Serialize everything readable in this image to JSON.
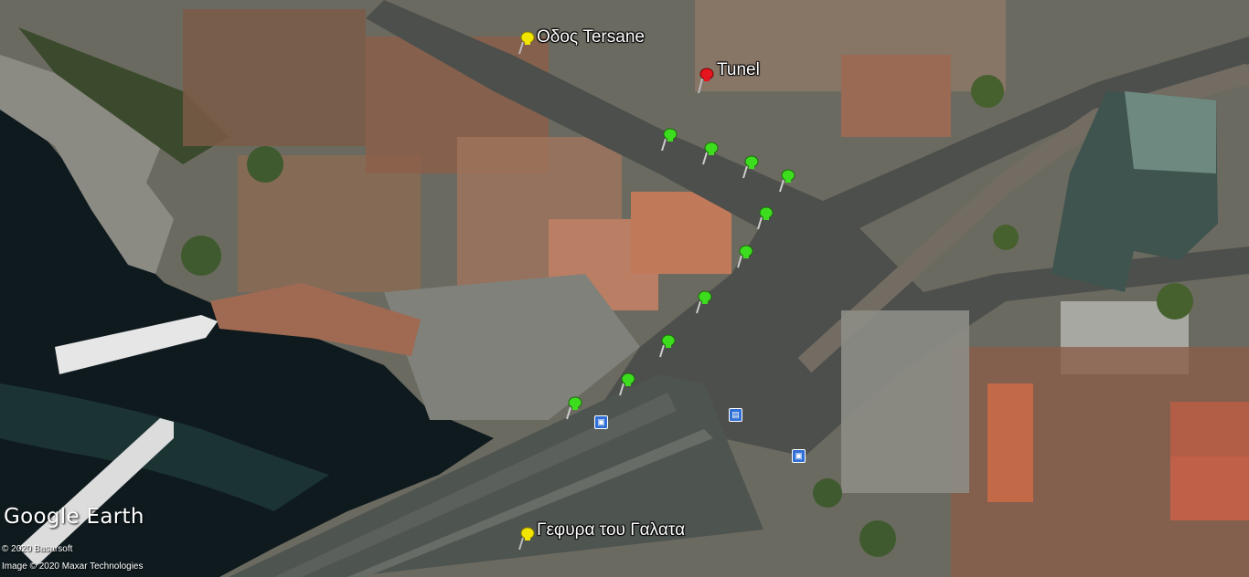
{
  "map": {
    "brand": "Google Earth",
    "credits": [
      "© 2020 Basarsoft",
      "Image © 2020 Maxar Technologies"
    ],
    "placemarks": [
      {
        "label": "Οδος Tersane",
        "color": "#f2e600",
        "icon": "yellow-pushpin-icon"
      },
      {
        "label": "Tunel",
        "color": "#e5141e",
        "icon": "red-pushpin-icon"
      },
      {
        "label": "Γεφυρα του Γαλατα",
        "color": "#f2e600",
        "icon": "yellow-pushpin-icon"
      }
    ],
    "route_pins": {
      "count": 10,
      "color": "#3ddc1e",
      "icon": "green-pushpin-icon"
    },
    "poi_icons": [
      "bus-stop-icon",
      "tram-stop-icon",
      "bus-stop-icon"
    ]
  }
}
